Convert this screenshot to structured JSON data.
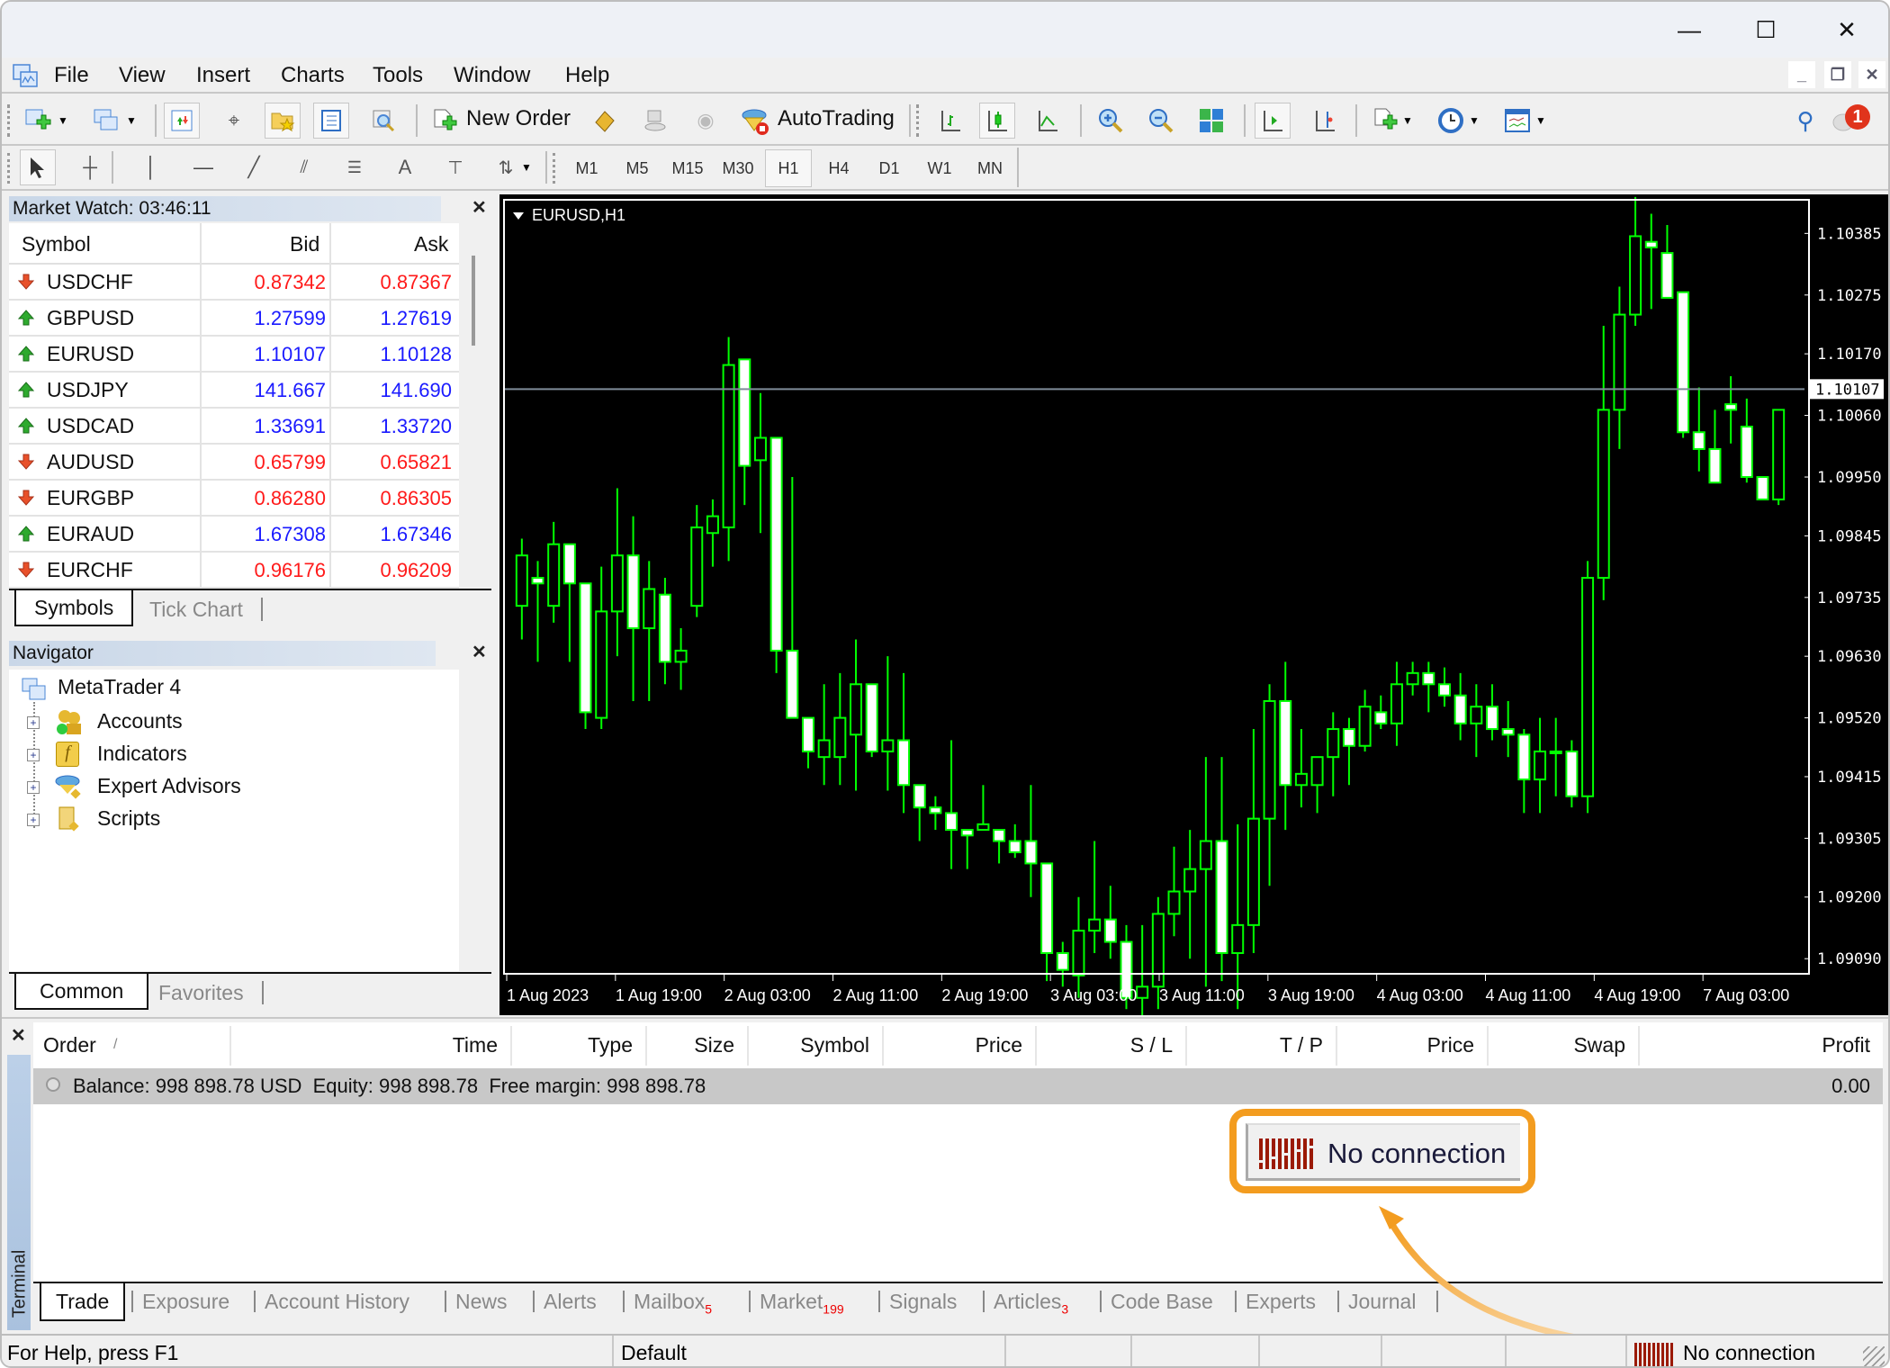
{
  "window": {
    "controls": {
      "minimize": "—",
      "maximize": "☐",
      "close": "✕"
    }
  },
  "menu": [
    "File",
    "View",
    "Insert",
    "Charts",
    "Tools",
    "Window",
    "Help"
  ],
  "mdi_controls": {
    "minimize": "_",
    "restore": "❐",
    "close": "✕"
  },
  "toolbar": {
    "new_order": "New Order",
    "autotrading": "AutoTrading",
    "notification_count": "1"
  },
  "timeframes": [
    "M1",
    "M5",
    "M15",
    "M30",
    "H1",
    "H4",
    "D1",
    "W1",
    "MN"
  ],
  "active_timeframe": "H1",
  "market_watch": {
    "title": "Market Watch: 03:46:11",
    "columns": [
      "Symbol",
      "Bid",
      "Ask"
    ],
    "rows": [
      {
        "symbol": "USDCHF",
        "bid": "0.87342",
        "ask": "0.87367",
        "dir": "down"
      },
      {
        "symbol": "GBPUSD",
        "bid": "1.27599",
        "ask": "1.27619",
        "dir": "up"
      },
      {
        "symbol": "EURUSD",
        "bid": "1.10107",
        "ask": "1.10128",
        "dir": "up"
      },
      {
        "symbol": "USDJPY",
        "bid": "141.667",
        "ask": "141.690",
        "dir": "up"
      },
      {
        "symbol": "USDCAD",
        "bid": "1.33691",
        "ask": "1.33720",
        "dir": "up"
      },
      {
        "symbol": "AUDUSD",
        "bid": "0.65799",
        "ask": "0.65821",
        "dir": "down"
      },
      {
        "symbol": "EURGBP",
        "bid": "0.86280",
        "ask": "0.86305",
        "dir": "down"
      },
      {
        "symbol": "EURAUD",
        "bid": "1.67308",
        "ask": "1.67346",
        "dir": "up"
      },
      {
        "symbol": "EURCHF",
        "bid": "0.96176",
        "ask": "0.96209",
        "dir": "down"
      }
    ],
    "tabs": [
      "Symbols",
      "Tick Chart"
    ],
    "colors": {
      "up": "#1a1aff",
      "down": "#ff1a1a"
    }
  },
  "navigator": {
    "title": "Navigator",
    "root": "MetaTrader 4",
    "items": [
      "Accounts",
      "Indicators",
      "Expert Advisors",
      "Scripts"
    ],
    "tabs": [
      "Common",
      "Favorites"
    ]
  },
  "chart": {
    "title": "EURUSD,H1",
    "current_price": "1.10107",
    "y_ticks": [
      "1.10385",
      "1.10275",
      "1.10170",
      "1.10060",
      "1.09950",
      "1.09845",
      "1.09735",
      "1.09630",
      "1.09520",
      "1.09415",
      "1.09305",
      "1.09200",
      "1.09090"
    ],
    "x_ticks": [
      "1 Aug 2023",
      "1 Aug 19:00",
      "2 Aug 03:00",
      "2 Aug 11:00",
      "2 Aug 19:00",
      "3 Aug 03:00",
      "3 Aug 11:00",
      "3 Aug 19:00",
      "4 Aug 03:00",
      "4 Aug 11:00",
      "4 Aug 19:00",
      "7 Aug 03:00"
    ]
  },
  "chart_data": {
    "type": "candlestick",
    "title": "EURUSD,H1",
    "ylim": [
      1.0909,
      1.1045
    ],
    "current_bid": 1.10107,
    "y_ticks": [
      1.10385,
      1.10275,
      1.1017,
      1.1006,
      1.0995,
      1.09845,
      1.09735,
      1.0963,
      1.0952,
      1.09415,
      1.09305,
      1.092,
      1.0909
    ],
    "x_ticks": [
      "1 Aug 2023",
      "1 Aug 19:00",
      "2 Aug 03:00",
      "2 Aug 11:00",
      "2 Aug 19:00",
      "3 Aug 03:00",
      "3 Aug 11:00",
      "3 Aug 19:00",
      "4 Aug 03:00",
      "4 Aug 11:00",
      "4 Aug 19:00",
      "7 Aug 03:00"
    ],
    "candles": [
      [
        1.0972,
        1.0984,
        1.0966,
        1.0981
      ],
      [
        1.0977,
        1.098,
        1.0962,
        1.0976
      ],
      [
        1.0972,
        1.0987,
        1.0969,
        1.0983
      ],
      [
        1.0983,
        1.0983,
        1.0962,
        1.0976
      ],
      [
        1.0976,
        1.0976,
        1.095,
        1.0953
      ],
      [
        1.0952,
        1.0979,
        1.095,
        1.0971
      ],
      [
        1.0971,
        1.0993,
        1.0963,
        1.0981
      ],
      [
        1.0981,
        1.0988,
        1.0955,
        1.0968
      ],
      [
        1.0968,
        1.098,
        1.0955,
        1.0975
      ],
      [
        1.0974,
        1.0977,
        1.0958,
        1.0962
      ],
      [
        1.0962,
        1.0968,
        1.0957,
        1.0964
      ],
      [
        1.0972,
        1.099,
        1.097,
        1.0986
      ],
      [
        1.0985,
        1.0991,
        1.0979,
        1.0988
      ],
      [
        1.0986,
        1.102,
        1.098,
        1.1015
      ],
      [
        1.1016,
        1.1016,
        1.099,
        1.0997
      ],
      [
        1.0998,
        1.101,
        1.0985,
        1.1002
      ],
      [
        1.1002,
        1.1002,
        1.096,
        1.0964
      ],
      [
        1.0964,
        1.0995,
        1.0958,
        1.0952
      ],
      [
        1.0952,
        1.0952,
        1.0943,
        1.0946
      ],
      [
        1.0945,
        1.0958,
        1.094,
        1.0948
      ],
      [
        1.0945,
        1.096,
        1.094,
        1.0952
      ],
      [
        1.0949,
        1.0966,
        1.0939,
        1.0958
      ],
      [
        1.0958,
        1.0958,
        1.0945,
        1.0946
      ],
      [
        1.0946,
        1.0963,
        1.0939,
        1.0948
      ],
      [
        1.0948,
        1.096,
        1.0935,
        1.094
      ],
      [
        1.094,
        1.094,
        1.093,
        1.0936
      ],
      [
        1.0936,
        1.0938,
        1.0932,
        1.0935
      ],
      [
        1.0935,
        1.0948,
        1.0925,
        1.0932
      ],
      [
        1.0932,
        1.0932,
        1.0925,
        1.0931
      ],
      [
        1.0932,
        1.094,
        1.0933,
        1.0933
      ],
      [
        1.0932,
        1.0932,
        1.0926,
        1.093
      ],
      [
        1.093,
        1.0933,
        1.0927,
        1.0928
      ],
      [
        1.093,
        1.094,
        1.092,
        1.0926
      ],
      [
        1.0926,
        1.0926,
        1.0905,
        1.091
      ],
      [
        1.091,
        1.0912,
        1.0904,
        1.0907
      ],
      [
        1.0906,
        1.092,
        1.0902,
        1.0914
      ],
      [
        1.0914,
        1.093,
        1.091,
        1.0916
      ],
      [
        1.0916,
        1.0922,
        1.0909,
        1.0912
      ],
      [
        1.0912,
        1.0915,
        1.09,
        1.0902
      ],
      [
        1.0902,
        1.0915,
        1.0898,
        1.0904
      ],
      [
        1.0904,
        1.092,
        1.09,
        1.0917
      ],
      [
        1.0917,
        1.0929,
        1.0913,
        1.0921
      ],
      [
        1.0921,
        1.0932,
        1.0909,
        1.0925
      ],
      [
        1.0925,
        1.0945,
        1.0904,
        1.093
      ],
      [
        1.093,
        1.0945,
        1.0905,
        1.091
      ],
      [
        1.091,
        1.0933,
        1.09,
        1.0915
      ],
      [
        1.0915,
        1.095,
        1.091,
        1.0934
      ],
      [
        1.0934,
        1.0958,
        1.0922,
        1.0955
      ],
      [
        1.0955,
        1.0962,
        1.0932,
        1.094
      ],
      [
        1.094,
        1.095,
        1.0936,
        1.0942
      ],
      [
        1.094,
        1.0945,
        1.0935,
        1.0945
      ],
      [
        1.0945,
        1.0953,
        1.0938,
        1.095
      ],
      [
        1.095,
        1.0952,
        1.094,
        1.0947
      ],
      [
        1.0947,
        1.0957,
        1.0946,
        1.0954
      ],
      [
        1.0953,
        1.0956,
        1.095,
        1.0951
      ],
      [
        1.0951,
        1.0962,
        1.0947,
        1.0958
      ],
      [
        1.0958,
        1.0962,
        1.0956,
        1.096
      ],
      [
        1.096,
        1.0962,
        1.0953,
        1.0958
      ],
      [
        1.0958,
        1.0961,
        1.0954,
        1.0956
      ],
      [
        1.0956,
        1.096,
        1.0948,
        1.0951
      ],
      [
        1.0951,
        1.0958,
        1.0945,
        1.0954
      ],
      [
        1.0954,
        1.0958,
        1.0948,
        1.095
      ],
      [
        1.095,
        1.0955,
        1.0945,
        1.0949
      ],
      [
        1.0949,
        1.095,
        1.0935,
        1.0941
      ],
      [
        1.0941,
        1.0952,
        1.0935,
        1.0946
      ],
      [
        1.0946,
        1.0952,
        1.0938,
        1.0946
      ],
      [
        1.0946,
        1.0948,
        1.0936,
        1.0938
      ],
      [
        1.0938,
        1.098,
        1.0935,
        1.0977
      ],
      [
        1.0977,
        1.1022,
        1.0973,
        1.1007
      ],
      [
        1.1007,
        1.1029,
        1.1,
        1.1024
      ],
      [
        1.1024,
        1.1045,
        1.1022,
        1.1038
      ],
      [
        1.1037,
        1.1042,
        1.1025,
        1.1036
      ],
      [
        1.1035,
        1.104,
        1.1027,
        1.1027
      ],
      [
        1.1028,
        1.1027,
        1.1002,
        1.1003
      ],
      [
        1.1003,
        1.1011,
        1.0996,
        1.1
      ],
      [
        1.1,
        1.1007,
        1.0994,
        1.0994
      ],
      [
        1.1008,
        1.1013,
        1.1001,
        1.1007
      ],
      [
        1.1004,
        1.1009,
        1.0994,
        1.0995
      ],
      [
        1.0995,
        1.0995,
        1.0992,
        1.0991
      ],
      [
        1.0991,
        1.1007,
        1.099,
        1.1007
      ]
    ],
    "bull_style": "hollow green",
    "bear_style": "white fill green outline",
    "grid": false
  },
  "terminal": {
    "label": "Terminal",
    "columns": [
      "Order",
      "Time",
      "Type",
      "Size",
      "Symbol",
      "Price",
      "S / L",
      "T / P",
      "Price",
      "Swap",
      "Profit"
    ],
    "sort_indicator": "/",
    "balance_line": "Balance: 998 898.78 USD  Equity: 998 898.78  Free margin: 998 898.78",
    "profit": "0.00",
    "tabs": [
      {
        "label": "Trade",
        "badge": ""
      },
      {
        "label": "Exposure",
        "badge": ""
      },
      {
        "label": "Account History",
        "badge": ""
      },
      {
        "label": "News",
        "badge": ""
      },
      {
        "label": "Alerts",
        "badge": ""
      },
      {
        "label": "Mailbox",
        "badge": "5"
      },
      {
        "label": "Market",
        "badge": "199"
      },
      {
        "label": "Signals",
        "badge": ""
      },
      {
        "label": "Articles",
        "badge": "3"
      },
      {
        "label": "Code Base",
        "badge": ""
      },
      {
        "label": "Experts",
        "badge": ""
      },
      {
        "label": "Journal",
        "badge": ""
      }
    ]
  },
  "callout": {
    "text": "No connection",
    "color": "#f39c1f"
  },
  "statusbar": {
    "help": "For Help, press F1",
    "profile": "Default",
    "connection": "No connection"
  }
}
